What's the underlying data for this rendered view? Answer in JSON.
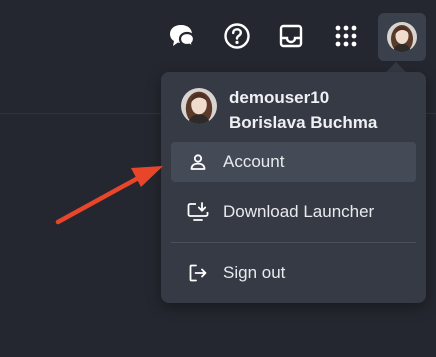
{
  "header": {
    "icons": [
      "chat-bubbles-icon",
      "help-circle-icon",
      "inbox-tray-icon",
      "apps-grid-icon"
    ]
  },
  "user_menu": {
    "username": "demouser10",
    "full_name": "Borislava Buchma",
    "items": [
      {
        "label": "Account",
        "icon": "user-icon",
        "active": true
      },
      {
        "label": "Download Launcher",
        "icon": "download-monitor-icon",
        "active": false
      },
      {
        "label": "Sign out",
        "icon": "sign-out-icon",
        "active": false
      }
    ]
  },
  "colors": {
    "background": "#24272f",
    "menu": "#363a45",
    "hover": "#454a57",
    "annotation_arrow": "#e8462b"
  }
}
